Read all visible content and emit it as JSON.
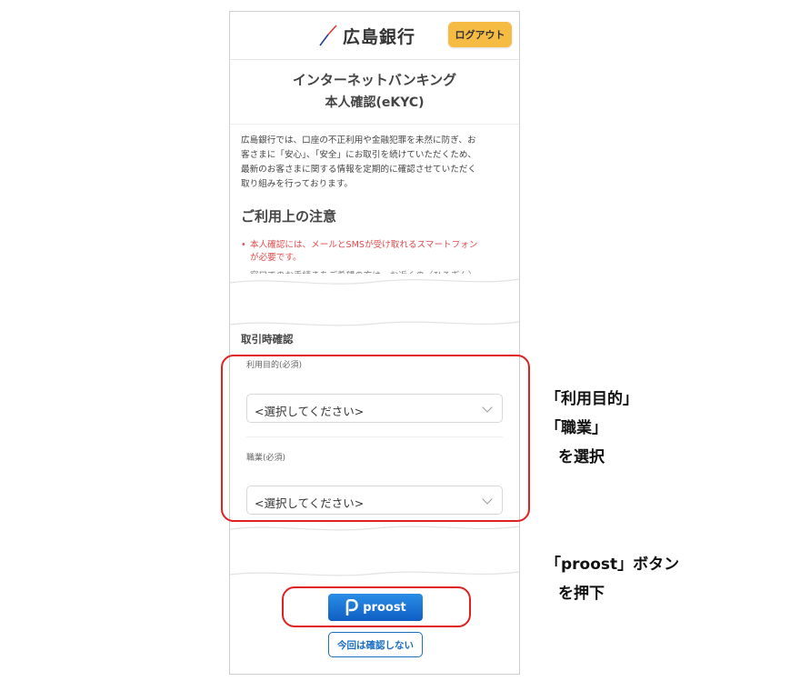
{
  "header": {
    "bank_name": "広島銀行",
    "logout_label": "ログアウト"
  },
  "title": {
    "line1": "インターネットバンキング",
    "line2": "本人確認(eKYC)"
  },
  "intro_lines": [
    "広島銀行では、口座の不正利用や金融犯罪を未然に防ぎ、お",
    "客さまに「安心」、「安全」にお取引を続けていただくため、",
    "最新のお客さまに関する情報を定期的に確認させていただく",
    "取り組みを行っております。"
  ],
  "notice": {
    "heading": "ご利用上の注意",
    "item1_line1": "本人確認には、メールとSMSが受け取れるスマートフォン",
    "item1_line2": "が必要です。",
    "item2_partial": "窓口でのお手続きをご希望の方は、お近くの〈ひろぎん〉"
  },
  "form": {
    "section_heading": "取引時確認",
    "purpose_label": "利用目的(必須)",
    "purpose_value": "<選択してください>",
    "occupation_label": "職業(必須)",
    "occupation_value": "<選択してください>"
  },
  "buttons": {
    "proost_label": "proost",
    "skip_label": "今回は確認しない"
  },
  "annotations": {
    "select_line1": "「利用目的」",
    "select_line2": "「職業」",
    "select_line3": "を選択",
    "proost_line1": "「proost」ボタン",
    "proost_line2": "を押下"
  },
  "colors": {
    "logout_button": "#f6bb43",
    "proost_button": "#0f5ec4",
    "notice_text": "#e24b4b",
    "highlight": "#e02020",
    "skip_button_border": "#1a6fc2"
  }
}
